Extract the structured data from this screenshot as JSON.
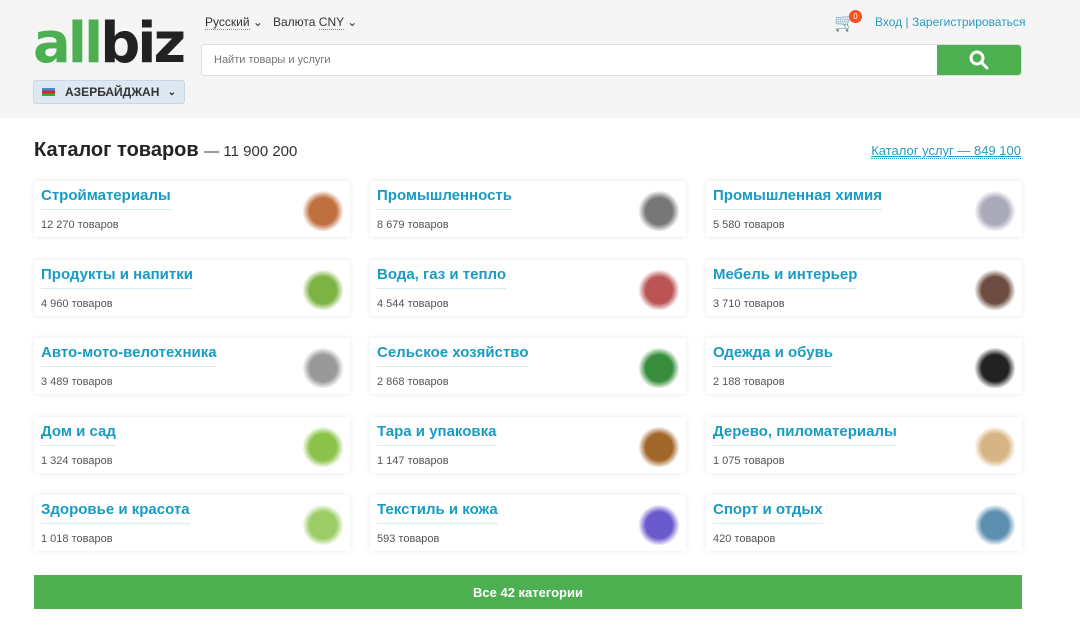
{
  "header": {
    "logo": "allbiz",
    "logo_green": "all",
    "logo_dark": "biz",
    "country": "АЗЕРБАЙДЖАН",
    "language": "Русский",
    "currency_prefix": "Валюта",
    "currency": "CNY",
    "search_placeholder": "Найти товары и услуги",
    "cart_count": "0",
    "login": "Вход",
    "separator": "|",
    "register": "Зарегистрироваться"
  },
  "catalog": {
    "title": "Каталог товаров",
    "count": "— 11 900 200",
    "services_link": "Каталог услуг — 849 100",
    "all_button": "Все 42 категории",
    "categories": [
      {
        "name": "Стройматериалы",
        "count": "12 270 товаров",
        "color": "#c0703f"
      },
      {
        "name": "Промышленность",
        "count": "8 679 товаров",
        "color": "#777"
      },
      {
        "name": "Промышленная химия",
        "count": "5 580 товаров",
        "color": "#aab"
      },
      {
        "name": "Продукты и напитки",
        "count": "4 960 товаров",
        "color": "#7cb342"
      },
      {
        "name": "Вода, газ и тепло",
        "count": "4 544 товаров",
        "color": "#b55"
      },
      {
        "name": "Мебель и интерьер",
        "count": "3 710 товаров",
        "color": "#6d4c41"
      },
      {
        "name": "Авто-мото-велотехника",
        "count": "3 489 товаров",
        "color": "#999"
      },
      {
        "name": "Сельское хозяйство",
        "count": "2 868 товаров",
        "color": "#388e3c"
      },
      {
        "name": "Одежда и обувь",
        "count": "2 188 товаров",
        "color": "#222"
      },
      {
        "name": "Дом и сад",
        "count": "1 324 товаров",
        "color": "#8bc34a"
      },
      {
        "name": "Тара и упаковка",
        "count": "1 147 товаров",
        "color": "#a0662a"
      },
      {
        "name": "Дерево, пиломатериалы",
        "count": "1 075 товаров",
        "color": "#d7b483"
      },
      {
        "name": "Здоровье и красота",
        "count": "1 018 товаров",
        "color": "#9ccc65"
      },
      {
        "name": "Текстиль и кожа",
        "count": "593 товаров",
        "color": "#6a5acd"
      },
      {
        "name": "Спорт и отдых",
        "count": "420 товаров",
        "color": "#5c8fb0"
      }
    ]
  }
}
